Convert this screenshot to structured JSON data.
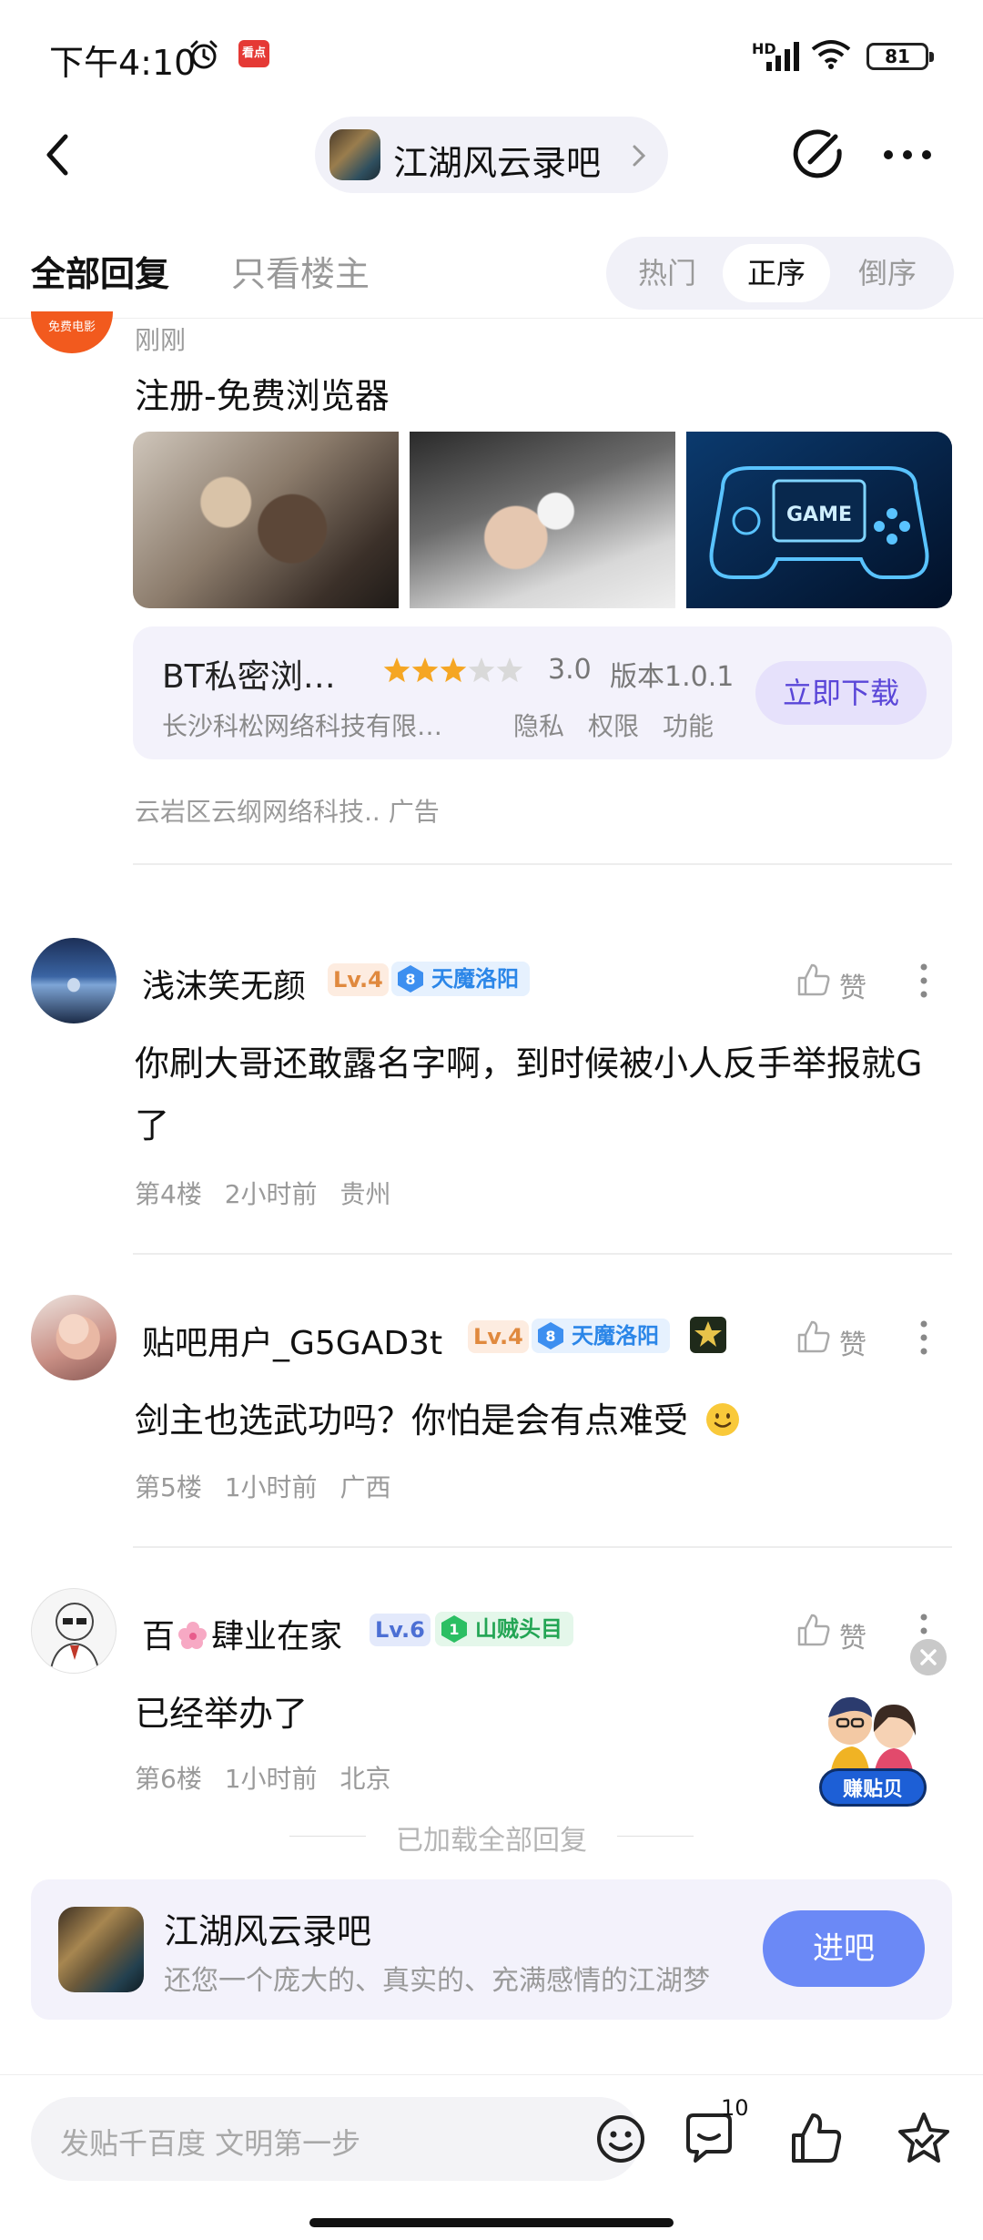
{
  "status_bar": {
    "time": "下午4:10",
    "app_icon_text": "看点",
    "network": "HD",
    "battery": "81"
  },
  "nav": {
    "forum_name": "江湖风云录吧"
  },
  "filter": {
    "tab_all": "全部回复",
    "tab_owner": "只看楼主",
    "sort_hot": "热门",
    "sort_asc": "正序",
    "sort_desc": "倒序",
    "selected_sort": "正序"
  },
  "ad_post": {
    "avatar_text": "免费电影",
    "time": "刚刚",
    "title": "注册-免费浏览器",
    "image3_text": "GAME",
    "app": {
      "name": "BT私密浏…",
      "rating_value": 3.0,
      "rating": "3.0",
      "stars_filled": 3,
      "stars_total": 5,
      "version": "版本1.0.1",
      "company": "长沙科松网络科技有限…",
      "privacy": "隐私",
      "permissions": "权限",
      "features": "功能",
      "download": "立即下载"
    },
    "footer": "云岩区云纲网络科技..  广告"
  },
  "comments": [
    {
      "name": "浅沫笑无颜",
      "level": "Lv.4",
      "title_level": "8",
      "title": "天魔洛阳",
      "text": "你刷大哥还敢露名字啊，到时候被小人反手举报就G了",
      "floor": "第4楼",
      "time": "2小时前",
      "location": "贵州",
      "like": "赞"
    },
    {
      "name": "贴吧用户_G5GAD3t",
      "level": "Lv.4",
      "title_level": "8",
      "title": "天魔洛阳",
      "text": "剑主也选武功吗？你怕是会有点难受",
      "floor": "第5楼",
      "time": "1小时前",
      "location": "广西",
      "like": "赞"
    },
    {
      "name_prefix": "百",
      "name_suffix": "肆业在家",
      "level": "Lv.6",
      "title_level": "1",
      "title": "山贼头目",
      "text": "已经举办了",
      "floor": "第6楼",
      "time": "1小时前",
      "location": "北京",
      "like": "赞"
    }
  ],
  "loaded_all": "已加载全部回复",
  "float_badge": "赚贴贝",
  "forum_card": {
    "name": "江湖风云录吧",
    "description": "还您一个庞大的、真实的、充满感情的江湖梦",
    "enter": "进吧"
  },
  "bottom_bar": {
    "placeholder": "发贴千百度 文明第一步",
    "comment_count": "10"
  },
  "colors": {
    "accent": "#6b89f6",
    "download_text": "#5a46d8",
    "star": "#f5a623",
    "level_orange": "#e0893e",
    "level_blue": "#4c6fd4",
    "title_blue": "#2b86e8",
    "title_green": "#23a554"
  },
  "icons": [
    "alarm-icon",
    "signal-icon",
    "wifi-icon",
    "back-icon",
    "chevron-right-icon",
    "edit-icon",
    "more-icon",
    "star-icon",
    "thumbs-up-icon",
    "kebab-icon",
    "close-icon",
    "emoji-icon",
    "comment-icon",
    "favorite-star-icon"
  ]
}
